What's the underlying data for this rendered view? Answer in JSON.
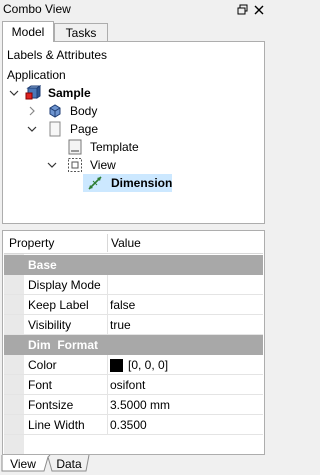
{
  "window": {
    "title": "Combo View",
    "float_icon": "restore-icon",
    "close_icon": "close-icon"
  },
  "top_tabs": [
    {
      "label": "Model",
      "active": true
    },
    {
      "label": "Tasks",
      "active": false
    }
  ],
  "tree": {
    "header": "Labels & Attributes",
    "root_label": "Application",
    "items": [
      {
        "label": "Sample",
        "bold": true,
        "icon": "document-icon",
        "expanded": true
      },
      {
        "label": "Body",
        "bold": false,
        "icon": "body-icon",
        "expanded": false
      },
      {
        "label": "Page",
        "bold": false,
        "icon": "page-icon",
        "expanded": true
      },
      {
        "label": "Template",
        "bold": false,
        "icon": "template-icon"
      },
      {
        "label": "View",
        "bold": false,
        "icon": "view-icon",
        "expanded": true
      },
      {
        "label": "Dimension",
        "bold": true,
        "icon": "dimension-icon",
        "selected": true
      }
    ]
  },
  "properties": {
    "col_property": "Property",
    "col_value": "Value",
    "groups": [
      {
        "name": "Base",
        "rows": [
          {
            "name": "Display Mode",
            "value": ""
          },
          {
            "name": "Keep Label",
            "value": "false"
          },
          {
            "name": "Visibility",
            "value": "true"
          }
        ]
      },
      {
        "name": "Dim  Format",
        "rows": [
          {
            "name": "Color",
            "value": "[0, 0, 0]",
            "swatch": "#000000"
          },
          {
            "name": "Font",
            "value": "osifont"
          },
          {
            "name": "Fontsize",
            "value": "3.5000 mm"
          },
          {
            "name": "Line Width",
            "value": "0.3500"
          }
        ]
      }
    ]
  },
  "bottom_tabs": [
    {
      "label": "View",
      "active": true
    },
    {
      "label": "Data",
      "active": false
    }
  ],
  "colors": {
    "group_header": "#a8a8a8",
    "selection": "#cce8ff"
  }
}
